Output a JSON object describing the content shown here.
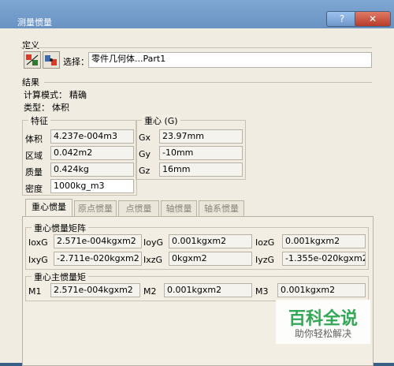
{
  "window": {
    "title": "测量惯量",
    "help": "?",
    "close": "✕"
  },
  "definition": {
    "group_label": "定义",
    "selection_label": "选择：",
    "selection_value": "零件几何体...Part1",
    "icons": [
      "measure-item-icon",
      "measure-inertia-icon"
    ]
  },
  "result": {
    "group_label": "结果",
    "calc_mode_label": "计算模式：",
    "calc_mode_value": "精确",
    "type_label": "类型：",
    "type_value": "体积"
  },
  "features": {
    "group_label": "特征",
    "rows": [
      {
        "label": "体积",
        "value": "4.237e-004m3"
      },
      {
        "label": "区域",
        "value": "0.042m2"
      },
      {
        "label": "质量",
        "value": "0.424kg"
      },
      {
        "label": "密度",
        "value": "1000kg_m3"
      }
    ]
  },
  "center": {
    "group_label": "重心 (G)",
    "rows": [
      {
        "label": "Gx",
        "value": "23.97mm"
      },
      {
        "label": "Gy",
        "value": "-10mm"
      },
      {
        "label": "Gz",
        "value": "16mm"
      }
    ]
  },
  "tabs": [
    "重心惯量",
    "原点惯量",
    "点惯量",
    "轴惯量",
    "轴系惯量"
  ],
  "inertia_matrix": {
    "group_label": "重心惯量矩阵",
    "row1": [
      {
        "label": "IoxG",
        "value": "2.571e-004kgxm2"
      },
      {
        "label": "IoyG",
        "value": "0.001kgxm2"
      },
      {
        "label": "IozG",
        "value": "0.001kgxm2"
      }
    ],
    "row2": [
      {
        "label": "IxyG",
        "value": "-2.711e-020kgxm2"
      },
      {
        "label": "IxzG",
        "value": "0kgxm2"
      },
      {
        "label": "IyzG",
        "value": "-1.355e-020kgxm2"
      }
    ]
  },
  "principal": {
    "group_label": "重心主惯量矩",
    "row": [
      {
        "label": "M1",
        "value": "2.571e-004kgxm2"
      },
      {
        "label": "M2",
        "value": "0.001kgxm2"
      },
      {
        "label": "M3",
        "value": "0.001kgxm2"
      }
    ]
  },
  "watermark": {
    "line1": "百科全说",
    "line2": "助你轻松解决"
  }
}
